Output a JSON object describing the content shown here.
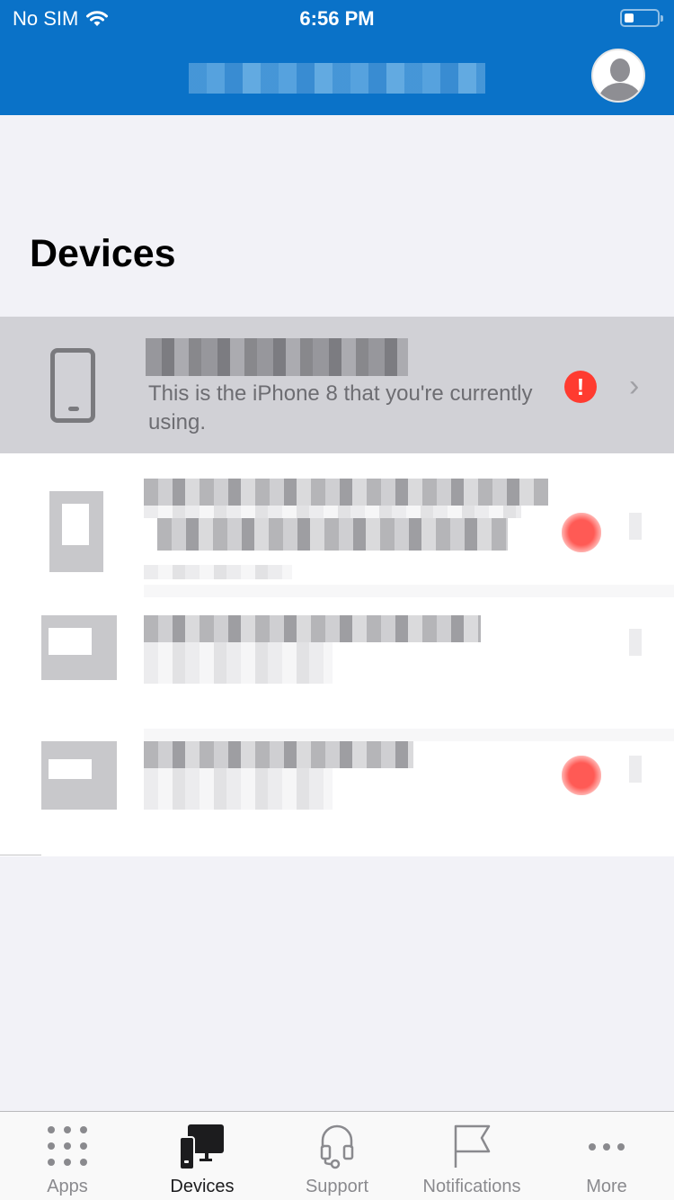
{
  "status_bar": {
    "carrier": "No SIM",
    "time": "6:56 PM",
    "battery_level_fraction": 0.2
  },
  "header": {
    "title": "[redacted]",
    "avatar_icon": "person-circle-icon",
    "colors": {
      "background": "#0a72c8"
    }
  },
  "page": {
    "title": "Devices"
  },
  "devices": [
    {
      "name": "[redacted]",
      "subtitle": "This is the iPhone 8 that you're currently using.",
      "icon": "phone-icon",
      "status_icon": "alert-icon",
      "status_color": "#ff3b30",
      "selected": true
    },
    {
      "name": "[redacted]",
      "subtitle": "[redacted]",
      "icon": "phone-icon",
      "status_icon": "alert-icon"
    },
    {
      "name": "[redacted]",
      "subtitle": "[redacted]",
      "icon": "laptop-icon",
      "status_icon": ""
    },
    {
      "name": "[redacted]",
      "subtitle": "[redacted]",
      "icon": "laptop-icon",
      "status_icon": "alert-icon"
    }
  ],
  "tabbar": {
    "active": "Devices",
    "items": [
      {
        "label": "Apps",
        "icon": "grid-dots-icon"
      },
      {
        "label": "Devices",
        "icon": "devices-icon"
      },
      {
        "label": "Support",
        "icon": "headset-icon"
      },
      {
        "label": "Notifications",
        "icon": "flag-icon"
      },
      {
        "label": "More",
        "icon": "more-dots-icon"
      }
    ]
  }
}
